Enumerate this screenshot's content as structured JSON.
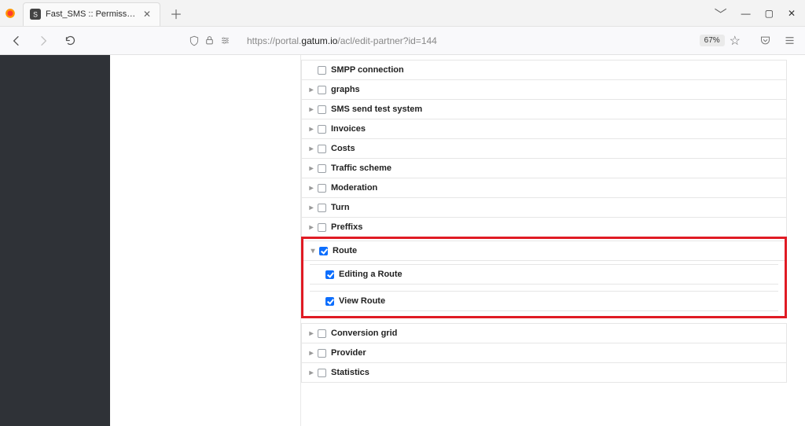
{
  "window": {
    "tab_title": "Fast_SMS :: Permissions",
    "minimize": "—",
    "maximize": "▢",
    "close": "✕"
  },
  "urlbar": {
    "scheme": "https://",
    "sub": "portal.",
    "host": "gatum.io",
    "path": "/acl/edit-partner?id=144",
    "zoom": "67%"
  },
  "permissions": [
    {
      "id": "smpp",
      "label": "SMPP connection",
      "checked": false,
      "hasToggle": false
    },
    {
      "id": "graphs",
      "label": "graphs",
      "checked": false,
      "hasToggle": true
    },
    {
      "id": "sms-test",
      "label": "SMS send test system",
      "checked": false,
      "hasToggle": true
    },
    {
      "id": "invoices",
      "label": "Invoices",
      "checked": false,
      "hasToggle": true
    },
    {
      "id": "costs",
      "label": "Costs",
      "checked": false,
      "hasToggle": true
    },
    {
      "id": "traffic",
      "label": "Traffic scheme",
      "checked": false,
      "hasToggle": true
    },
    {
      "id": "moderation",
      "label": "Moderation",
      "checked": false,
      "hasToggle": true
    },
    {
      "id": "turn",
      "label": "Turn",
      "checked": false,
      "hasToggle": true
    },
    {
      "id": "preffixs",
      "label": "Preffixs",
      "checked": false,
      "hasToggle": true
    }
  ],
  "highlighted": {
    "parent": {
      "id": "route",
      "label": "Route",
      "checked": true
    },
    "children": [
      {
        "id": "edit-route",
        "label": "Editing a Route",
        "checked": true
      },
      {
        "id": "view-route",
        "label": "View Route",
        "checked": true
      }
    ]
  },
  "permissions_after": [
    {
      "id": "conv-grid",
      "label": "Conversion grid",
      "checked": false,
      "hasToggle": true
    },
    {
      "id": "provider",
      "label": "Provider",
      "checked": false,
      "hasToggle": true
    },
    {
      "id": "statistics",
      "label": "Statistics",
      "checked": false,
      "hasToggle": true
    }
  ]
}
